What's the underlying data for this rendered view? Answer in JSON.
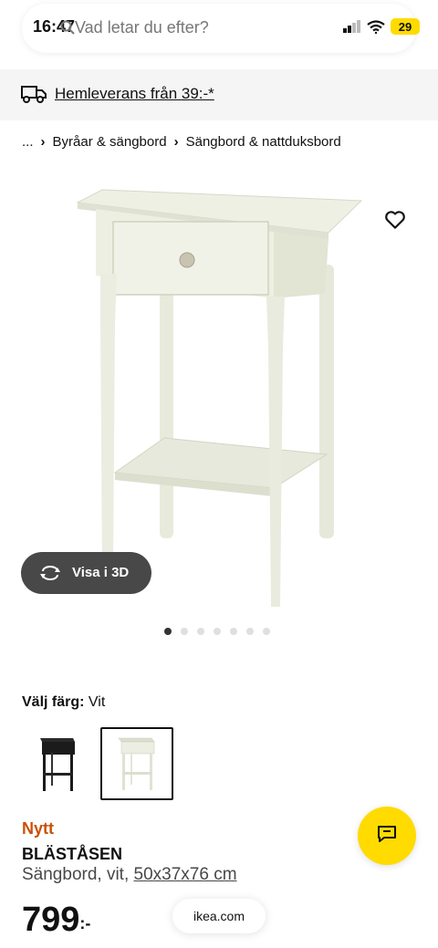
{
  "status_bar": {
    "time": "16:47",
    "battery": "29"
  },
  "search": {
    "placeholder": "Vad letar du efter?"
  },
  "delivery": {
    "text": "Hemleverans från 39:-*"
  },
  "breadcrumb": {
    "ellipsis": "...",
    "items": [
      "Byråar & sängbord",
      "Sängbord & nattduksbord"
    ]
  },
  "gallery": {
    "view3d_label": "Visa i 3D",
    "total_images": 7,
    "active_index": 0
  },
  "color": {
    "label": "Välj färg:",
    "selected": "Vit",
    "options": [
      "black",
      "white"
    ]
  },
  "product": {
    "badge": "Nytt",
    "name": "BLÄSTÅSEN",
    "description": "Sängbord, vit, ",
    "dimensions": "50x37x76 cm",
    "price": "799",
    "price_suffix": ":-"
  },
  "browser": {
    "url": "ikea.com"
  },
  "colors": {
    "accent_yellow": "#ffdb00",
    "new_orange": "#ca5008",
    "dark_pill": "#484848"
  },
  "icons": [
    "search-icon",
    "truck-icon",
    "heart-icon",
    "rotate-3d-icon",
    "chat-icon"
  ]
}
